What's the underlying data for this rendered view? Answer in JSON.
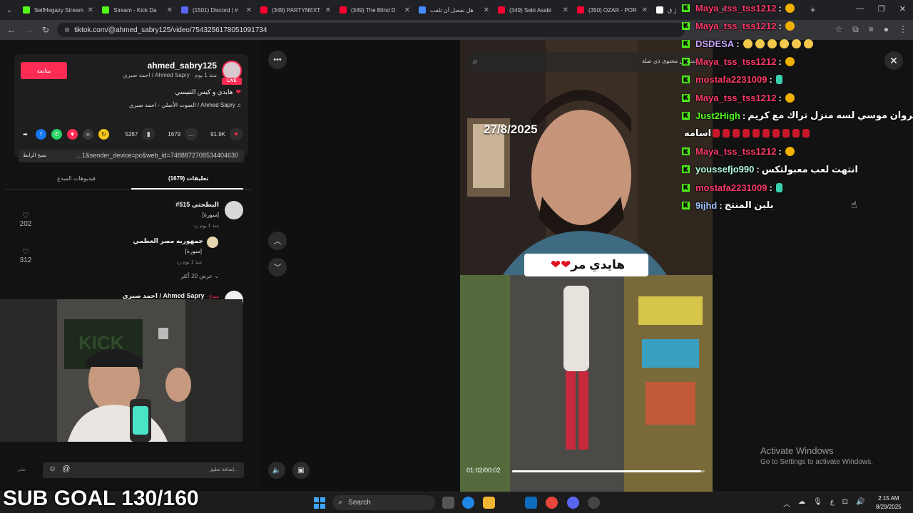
{
  "tabs": [
    {
      "label": "SeifHegazy Stream",
      "color": "#53fc18"
    },
    {
      "label": "Stream - Kick Da",
      "color": "#53fc18"
    },
    {
      "label": "(1501) Discord | #",
      "color": "#5865f2"
    },
    {
      "label": "(349) PARTYNEXT",
      "color": "#ff0033"
    },
    {
      "label": "(349) The Blind D",
      "color": "#ff0033"
    },
    {
      "label": "هل تفضل أن تلعب",
      "color": "#4a8cff"
    },
    {
      "label": "(349) Sebi Asabi",
      "color": "#ff0033"
    },
    {
      "label": "(350) OZAR - POR",
      "color": "#ff0033"
    },
    {
      "label": "ژ ق",
      "color": "#ffffff"
    }
  ],
  "address": {
    "url": "tiktok.com/@ahmed_sabry125/video/7543256178051091734"
  },
  "author": {
    "username": "ahmed_sabry125",
    "meta": "احمد صبري / Ahmed Sapry · منذ 1 يوم",
    "caption": "هايدي و كيس التنيسي",
    "sound": "الصوت الأصلي - احمد صبري / Ahmed Sapry",
    "follow_label": "متابعة",
    "live_label": "LIVE"
  },
  "stats": {
    "likes": "91.9K",
    "comments": "1679",
    "saves": "5267"
  },
  "link": {
    "copy_label": "نسخ الرابط",
    "text": "...1&sender_device=pc&web_id=7488872708534404630"
  },
  "panel_tabs": {
    "comments": "تعليقات (1679)",
    "creator_videos": "فيديوهات المبدع"
  },
  "comments": [
    {
      "user": "#البطحتي 515",
      "text": "[سورة]",
      "meta": "منذ 1 يوم    رد",
      "likes": "202"
    },
    {
      "user": "جمهوريه مصر العظمي",
      "text": "[سورة]",
      "meta": "منذ 1 يوم    رد",
      "likes": "312",
      "more": "عرض 20 أكثر"
    },
    {
      "user": "احمد صبري / Ahmed Sapry",
      "badge": "· مبدع"
    }
  ],
  "comment_input": {
    "placeholder": "إضافة تعليق...",
    "post_label": "نشر"
  },
  "video": {
    "date": "27/8/2025",
    "caption": "هايدي    مر",
    "time": "01:02/00:02",
    "progress_pct": 98,
    "search_placeholder": "ابحث عن محتوى ذي صلة"
  },
  "chat": [
    {
      "user": "Maya_tss_tss1212",
      "color": "#ff3a6b",
      "msg": "",
      "emotes": [
        "face"
      ]
    },
    {
      "user": "Maya_tss_tss1212",
      "color": "#ff3a6b",
      "msg": "",
      "emotes": [
        "face"
      ]
    },
    {
      "user": "DSDESA",
      "color": "#c7a6ff",
      "msg": "",
      "emotes": [
        "y",
        "y",
        "y",
        "y",
        "y",
        "y"
      ]
    },
    {
      "user": "Maya_tss_tss1212",
      "color": "#ff3a6b",
      "msg": "",
      "emotes": [
        "face"
      ]
    },
    {
      "user": "mostafa2231009",
      "color": "#ff3a6b",
      "msg": "",
      "emotes": [
        "teal"
      ]
    },
    {
      "user": "Maya_tss_tss1212",
      "color": "#ff3a6b",
      "msg": "",
      "emotes": [
        "face"
      ]
    },
    {
      "user": "Just2High",
      "color": "#53fc18",
      "msg": "ي سييف مروان موسي لسه منزل تراك مع كريم",
      "emotes": []
    },
    {
      "user": "",
      "color": "#ffffff",
      "msg": "اسامه",
      "emotes": [
        "r",
        "r",
        "r",
        "r",
        "r",
        "r",
        "r",
        "r",
        "r",
        "r"
      ]
    },
    {
      "user": "Maya_tss_tss1212",
      "color": "#ff3a6b",
      "msg": "",
      "emotes": [
        "face"
      ]
    },
    {
      "user": "youssefjo990",
      "color": "#b3ffe0",
      "msg": "انتهت لعب معبولتكس",
      "emotes": []
    },
    {
      "user": "mostafa2231009",
      "color": "#ff3a6b",
      "msg": "",
      "emotes": [
        "teal"
      ]
    },
    {
      "user": "9ijhd",
      "color": "#9fc4ff",
      "msg": "بلبن المنتج",
      "emotes": []
    }
  ],
  "windows_notice": {
    "title": "Activate Windows",
    "subtitle": "Go to Settings to activate Windows."
  },
  "stream": {
    "sub_goal": "SUB GOAL 130/160"
  },
  "taskbar": {
    "search": "Search",
    "time": "2:15 AM",
    "date": "8/29/2025",
    "lang": "ع"
  }
}
